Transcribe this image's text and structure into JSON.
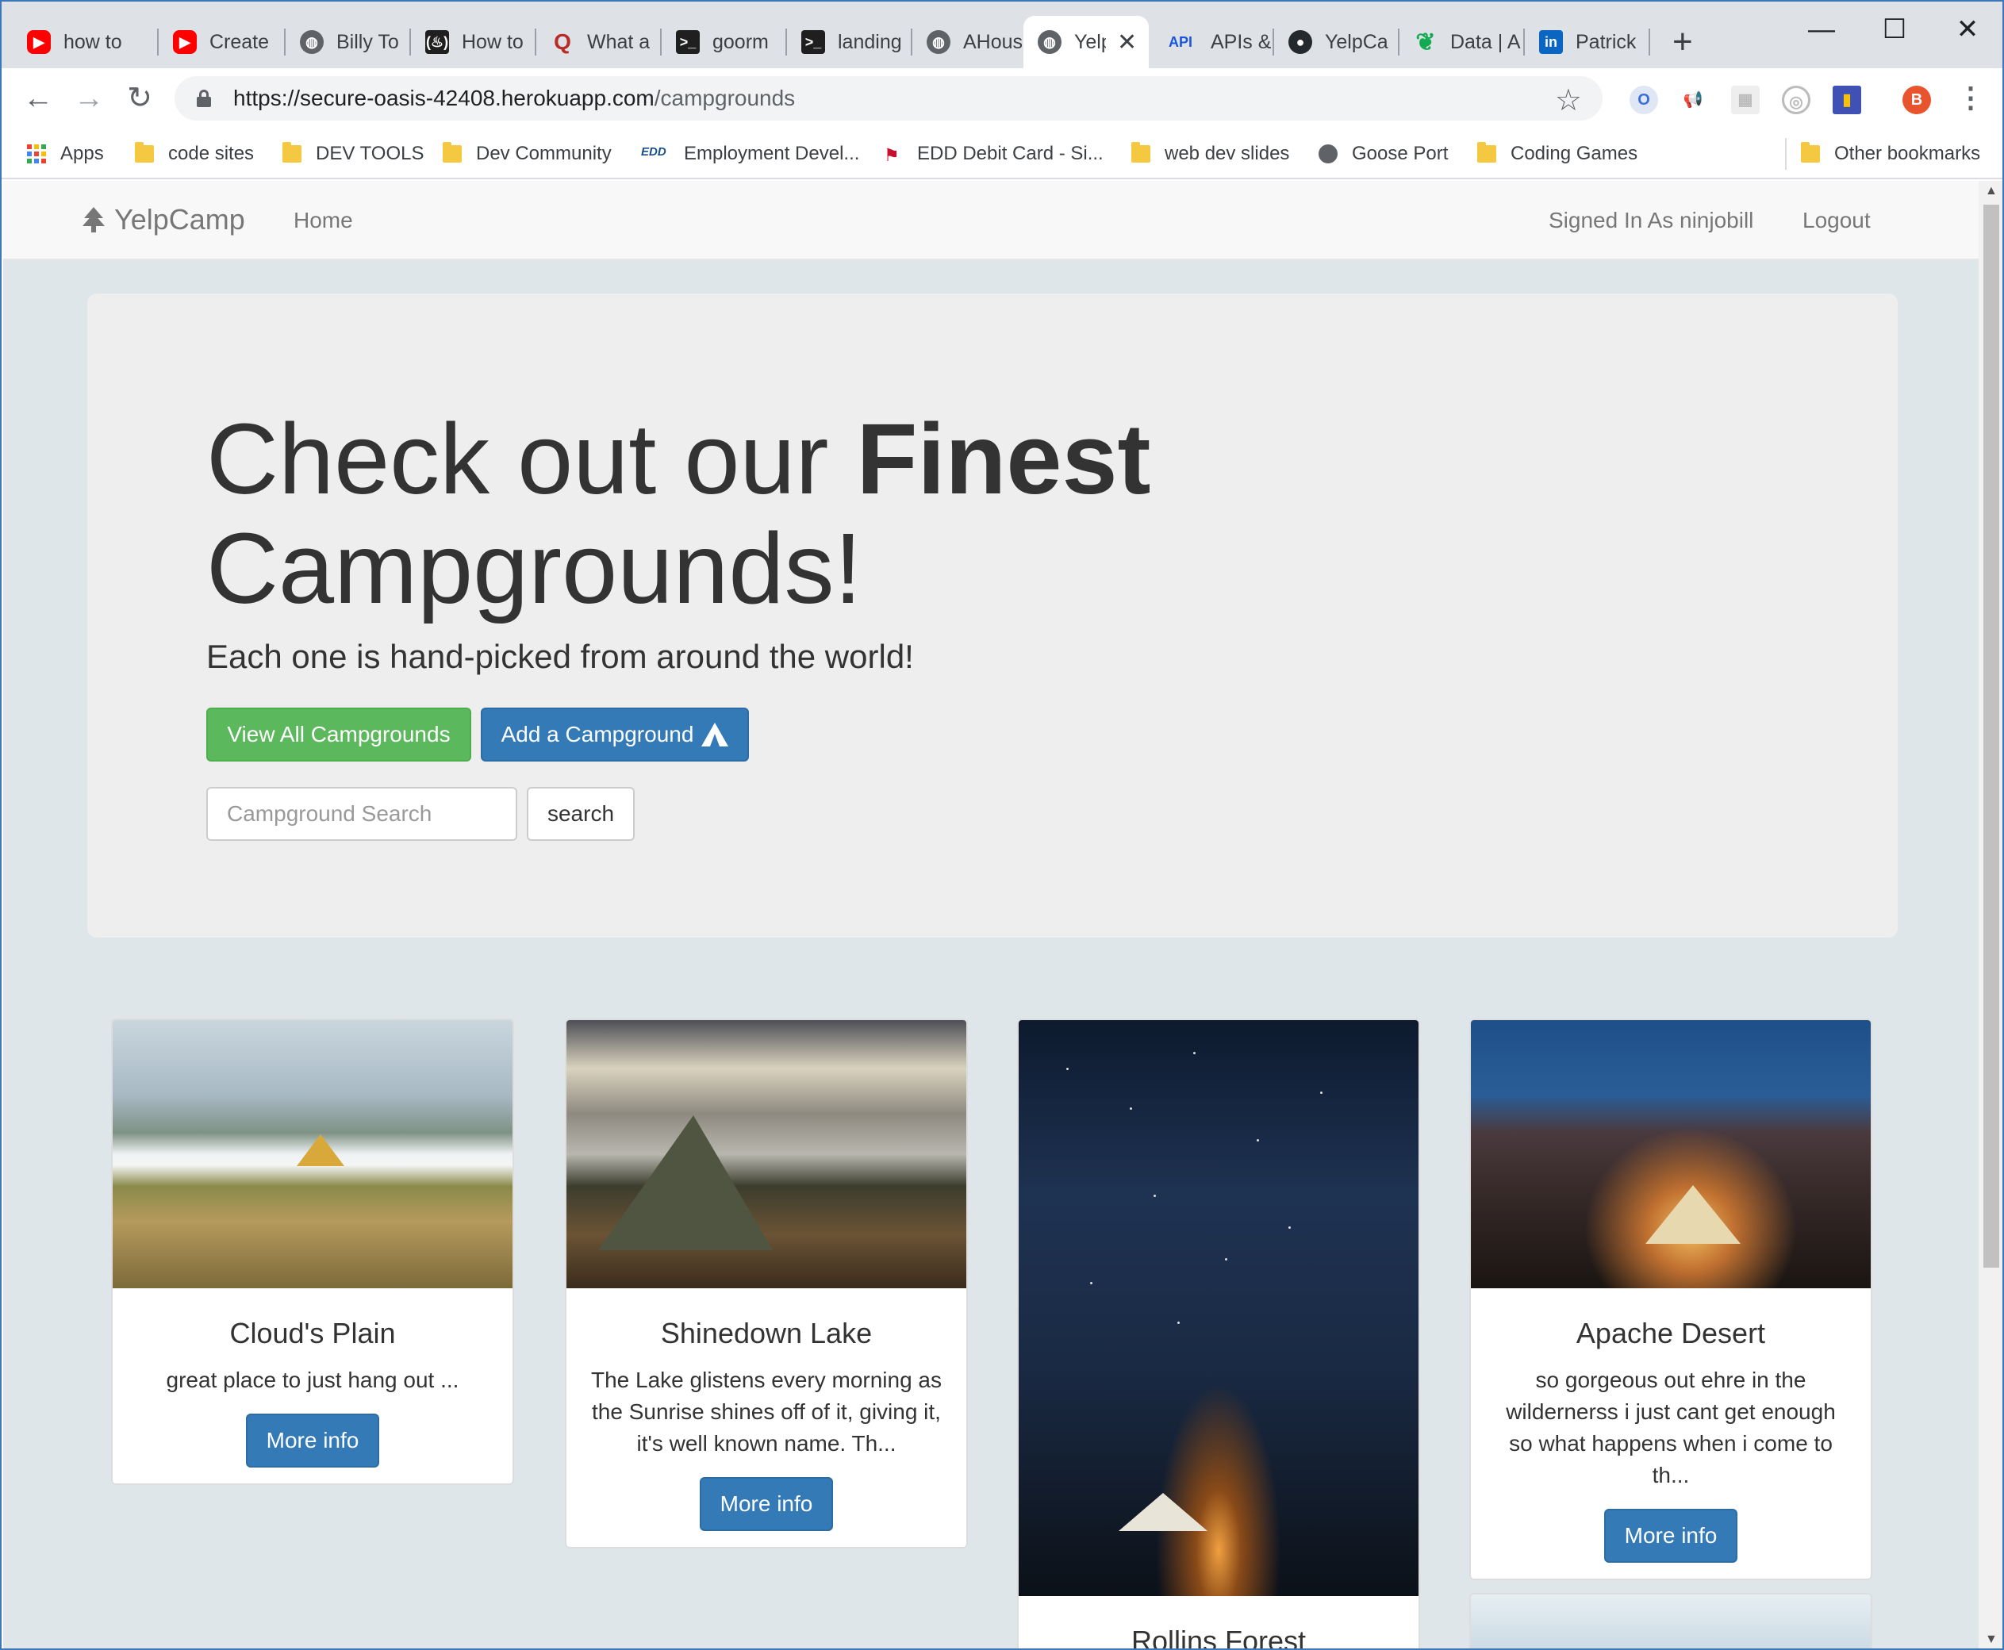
{
  "browser": {
    "tabs": [
      {
        "label": "how to",
        "icon": "youtube-icon"
      },
      {
        "label": "Create",
        "icon": "youtube-icon"
      },
      {
        "label": "Billy To",
        "icon": "globe-icon"
      },
      {
        "label": "How to",
        "icon": "freecodecamp-icon"
      },
      {
        "label": "What a",
        "icon": "quora-icon"
      },
      {
        "label": "goorm",
        "icon": "terminal-icon"
      },
      {
        "label": "landing",
        "icon": "terminal-icon"
      },
      {
        "label": "AHouse",
        "icon": "globe-icon"
      },
      {
        "label": "Yelp",
        "icon": "globe-icon",
        "active": true
      },
      {
        "label": "APIs &",
        "icon": "api-icon"
      },
      {
        "label": "YelpCa",
        "icon": "github-icon"
      },
      {
        "label": "Data | A",
        "icon": "mongodb-leaf-icon"
      },
      {
        "label": "Patrick",
        "icon": "linkedin-icon"
      }
    ],
    "url_host": "https://secure-oasis-42408.herokuapp.com",
    "url_path": "/campgrounds",
    "avatar_letter": "B",
    "bookmarks": [
      {
        "label": "Apps",
        "icon": "apps-grid-icon"
      },
      {
        "label": "code sites",
        "icon": "folder-icon"
      },
      {
        "label": "DEV TOOLS",
        "icon": "folder-icon"
      },
      {
        "label": "Dev Community",
        "icon": "folder-icon"
      },
      {
        "label": "Employment Devel...",
        "icon": "edd-icon"
      },
      {
        "label": "EDD Debit Card - Si...",
        "icon": "bank-icon"
      },
      {
        "label": "web dev slides",
        "icon": "folder-icon"
      },
      {
        "label": "Goose Port",
        "icon": "globe-icon"
      },
      {
        "label": "Coding Games",
        "icon": "folder-icon"
      },
      {
        "label": "Other bookmarks",
        "icon": "folder-icon"
      }
    ]
  },
  "site": {
    "brand": "YelpCamp",
    "nav_home": "Home",
    "signed_in": "Signed In As ninjobill",
    "logout": "Logout"
  },
  "hero": {
    "title_normal": "Check out our ",
    "title_bold": "Finest",
    "title_line2": "Campgrounds!",
    "subtitle": "Each one is hand-picked from around the world!",
    "view_all_label": "View All Campgrounds",
    "add_label": "Add a Campground",
    "search_placeholder": "Campground Search",
    "search_button": "search"
  },
  "campgrounds": [
    {
      "name": "Cloud's Plain",
      "description": "great place to just hang out ...",
      "button": "More info"
    },
    {
      "name": "Shinedown Lake",
      "description": "The Lake glistens every morning as the Sunrise shines off of it, giving it, it's well known name. Th...",
      "button": "More info"
    },
    {
      "name": "Rollins Forest",
      "description": "",
      "button": ""
    },
    {
      "name": "Apache Desert",
      "description": "so gorgeous out ehre in the wildernerss i just cant get enough so what happens when i come to th...",
      "button": "More info"
    }
  ],
  "colors": {
    "success": "#5cb85c",
    "primary": "#337ab7",
    "page_bg": "#dfe6ea",
    "jumbotron_bg": "#eeeeee"
  }
}
